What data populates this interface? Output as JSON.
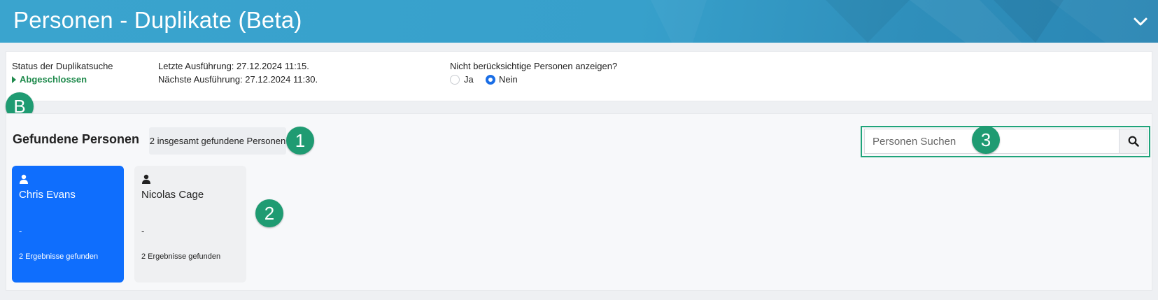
{
  "header": {
    "title": "Personen - Duplikate (Beta)"
  },
  "status": {
    "label": "Status der Duplikatsuche",
    "value": "Abgeschlossen",
    "last_run": "Letzte Ausführung: 27.12.2024 11:15.",
    "next_run": "Nächste Ausführung: 27.12.2024 11:30.",
    "show_question": "Nicht berücksichtige Personen anzeigen?",
    "options": [
      {
        "label": "Ja",
        "checked": false
      },
      {
        "label": "Nein",
        "checked": true
      }
    ]
  },
  "section": {
    "title": "Gefundene Personen",
    "count_text": "2 insgesamt gefundene Personen"
  },
  "search": {
    "placeholder": "Personen Suchen",
    "value": ""
  },
  "persons": [
    {
      "name": "Chris Evans",
      "detail": "-",
      "results": "2 Ergebnisse gefunden",
      "selected": true
    },
    {
      "name": "Nicolas Cage",
      "detail": "-",
      "results": "2 Ergebnisse gefunden",
      "selected": false
    }
  ],
  "callouts": {
    "b": "B",
    "one": "1",
    "two": "2",
    "three": "3"
  },
  "colors": {
    "header": "#37a0cb",
    "accent": "#0f6efd",
    "status_green": "#1f8a4c",
    "callout": "#1f9b72"
  },
  "icons": [
    "chevron-down-icon",
    "triangle-right-icon",
    "person-icon",
    "search-icon"
  ]
}
